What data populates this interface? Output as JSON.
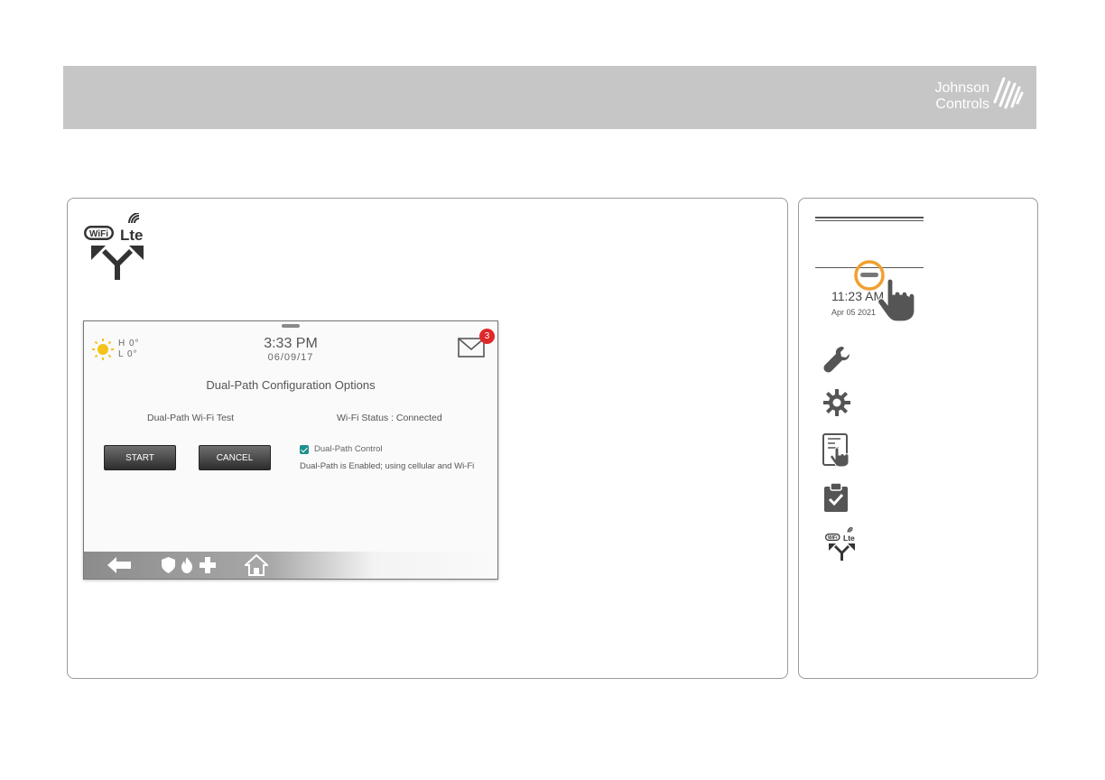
{
  "brand": {
    "line1": "Johnson",
    "line2": "Controls"
  },
  "device_screen": {
    "weather": {
      "high": "H 0°",
      "low": "L 0°"
    },
    "time": "3:33 PM",
    "date": "06/09/17",
    "mail_badge": "3",
    "title": "Dual-Path Configuration Options",
    "wifi_test_label": "Dual-Path Wi-Fi Test",
    "wifi_status_label": "Wi-Fi Status :  Connected",
    "start_label": "START",
    "cancel_label": "CANCEL",
    "dual_path_control_label": "Dual-Path Control",
    "dual_path_desc": "Dual-Path is Enabled; using cellular and Wi-Fi"
  },
  "sidebar": {
    "time": "11:23 AM",
    "date": "Apr 05 2021",
    "icons": [
      "wrench-icon",
      "gear-icon",
      "touch-panel-icon",
      "clipboard-check-icon",
      "wifi-lte-icon"
    ]
  },
  "icon_labels": {
    "wifi": "WiFi",
    "lte": "Lte"
  },
  "colors": {
    "banner": "#c6c6c6",
    "badge": "#e02828",
    "checkbox": "#1d8f8a",
    "touch_ring": "#f0a030"
  }
}
